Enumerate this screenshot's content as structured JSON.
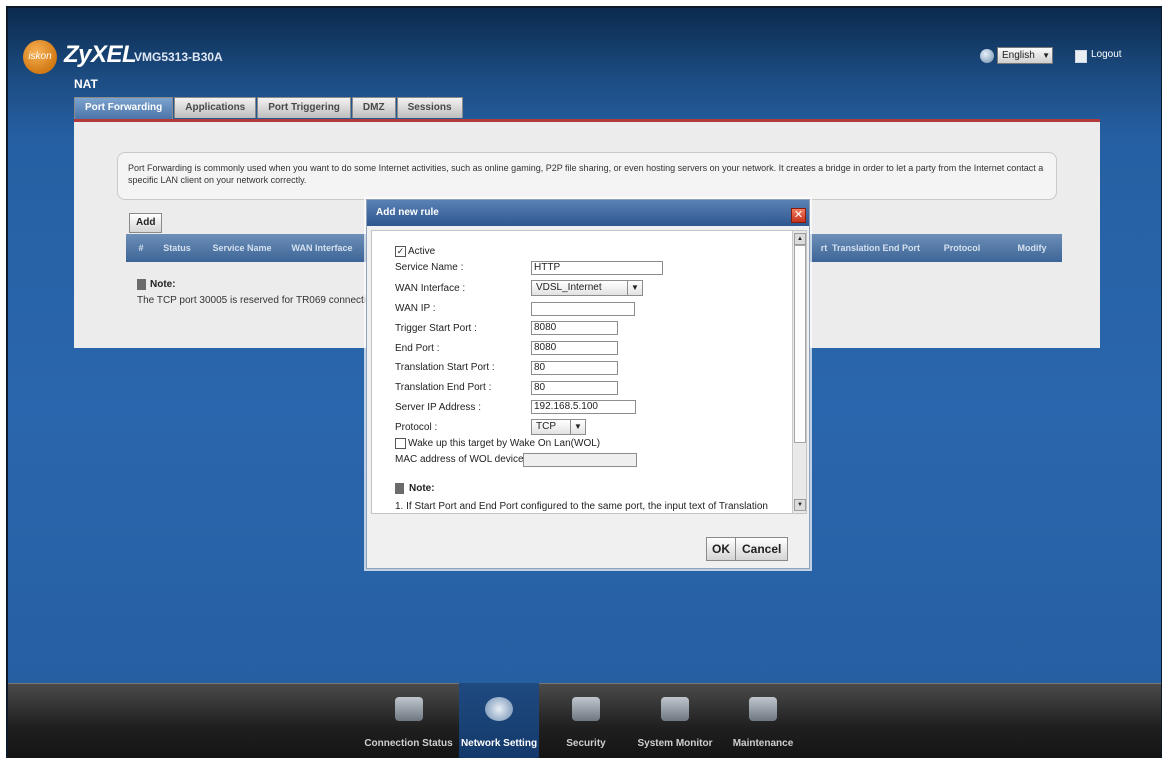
{
  "header": {
    "logo_text": "iskon",
    "brand": "ZyXEL",
    "model": "VMG5313-B30A",
    "language": "English",
    "logout": "Logout"
  },
  "page": {
    "title": "NAT",
    "tabs": [
      "Port Forwarding",
      "Applications",
      "Port Triggering",
      "DMZ",
      "Sessions"
    ],
    "active_tab": "Port Forwarding",
    "description": "Port Forwarding is commonly used when you want to do some Internet activities, such as online gaming, P2P file sharing, or even hosting servers on your network. It creates a bridge in order to let a party from the Internet contact a specific LAN client on your network correctly.",
    "add_label": "Add",
    "table_headers": [
      "#",
      "Status",
      "Service Name",
      "WAN Interface",
      "rt",
      "Translation End Port",
      "Protocol",
      "Modify"
    ],
    "note_title": "Note:",
    "note_text": "The TCP port 30005 is reserved for TR069 connectic"
  },
  "dialog": {
    "title": "Add new rule",
    "active_label": "Active",
    "active_checked": true,
    "service_name_label": "Service Name :",
    "service_name_value": "HTTP",
    "wan_interface_label": "WAN Interface :",
    "wan_interface_value": "VDSL_Internet",
    "wan_ip_label": "WAN IP :",
    "wan_ip_value": "",
    "trigger_start_label": "Trigger Start Port :",
    "trigger_start_value": "8080",
    "end_port_label": "End Port :",
    "end_port_value": "8080",
    "translation_start_label": "Translation Start Port :",
    "translation_start_value": "80",
    "translation_end_label": "Translation End Port :",
    "translation_end_value": "80",
    "server_ip_label": "Server IP Address :",
    "server_ip_value": "192.168.5.100",
    "protocol_label": "Protocol :",
    "protocol_value": "TCP",
    "wol_label": "Wake up this target by Wake On Lan(WOL)",
    "wol_checked": false,
    "mac_label": "MAC address of WOL device",
    "mac_value": "",
    "note_title": "Note:",
    "note_text": "1.  If Start Port and End Port configured to the same port, the input text of Translation",
    "ok_label": "OK",
    "cancel_label": "Cancel"
  },
  "footer": {
    "items": [
      "Connection Status",
      "Network Setting",
      "Security",
      "System Monitor",
      "Maintenance"
    ],
    "active": "Network Setting"
  },
  "colors": {
    "accent_red": "#b23a3a",
    "nav_blue": "#2660a3",
    "active_tab": "#5a80b0"
  }
}
